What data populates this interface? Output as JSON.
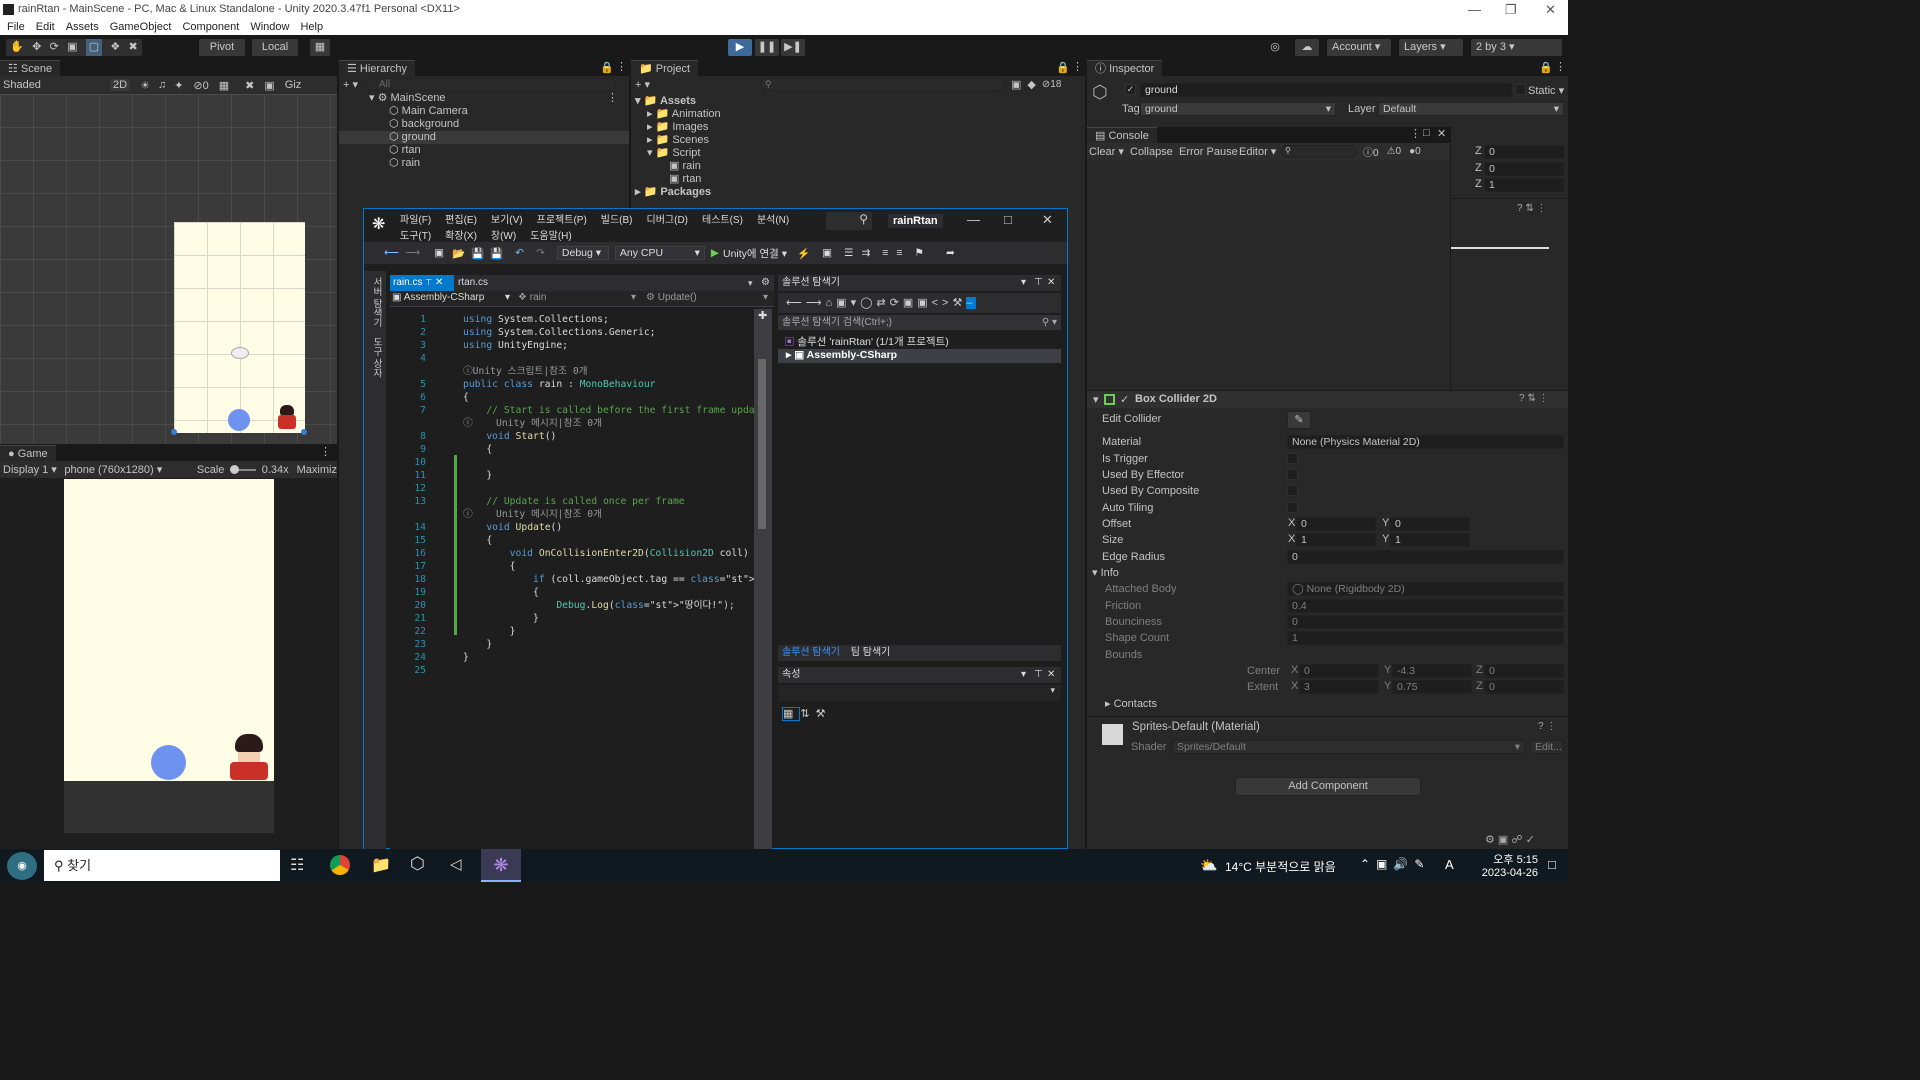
{
  "window": {
    "title": "rainRtan - MainScene - PC, Mac & Linux Standalone - Unity 2020.3.47f1 Personal <DX11>"
  },
  "menu": [
    "File",
    "Edit",
    "Assets",
    "GameObject",
    "Component",
    "Window",
    "Help"
  ],
  "toolbar": {
    "pivot": "Pivot",
    "local": "Local",
    "account": "Account",
    "layers": "Layers",
    "layout": "2 by 3"
  },
  "scene": {
    "tab": "Scene",
    "shading": "Shaded",
    "mode_2d": "2D",
    "gizmos": "Giz",
    "hidden_count": "0"
  },
  "game": {
    "tab": "Game",
    "display": "Display 1",
    "resolution": "phone (760x1280)",
    "scale_label": "Scale",
    "scale_value": "0.34x",
    "maximize": "Maximiz"
  },
  "hierarchy": {
    "tab": "Hierarchy",
    "search_placeholder": "All",
    "scene": "MainScene",
    "items": [
      "Main Camera",
      "background",
      "ground",
      "rtan",
      "rain"
    ]
  },
  "project": {
    "tab": "Project",
    "badge": "18",
    "root": "Assets",
    "folders": [
      "Animation",
      "Images",
      "Scenes",
      "Script"
    ],
    "scripts": [
      "rain",
      "rtan"
    ],
    "packages": "Packages"
  },
  "inspector": {
    "tab": "Inspector",
    "object_name": "ground",
    "static": "Static",
    "tag_label": "Tag",
    "tag": "ground",
    "layer_label": "Layer",
    "layer": "Default",
    "transform_z": [
      "0",
      "0",
      "1"
    ],
    "box_collider": {
      "title": "Box Collider 2D",
      "edit_collider": "Edit Collider",
      "material_label": "Material",
      "material": "None (Physics Material 2D)",
      "is_trigger": "Is Trigger",
      "used_by_effector": "Used By Effector",
      "used_by_composite": "Used By Composite",
      "auto_tiling": "Auto Tiling",
      "offset_label": "Offset",
      "offset_x": "0",
      "offset_y": "0",
      "size_label": "Size",
      "size_x": "1",
      "size_y": "1",
      "edge_radius_label": "Edge Radius",
      "edge_radius": "0",
      "info": "Info",
      "attached_body_label": "Attached Body",
      "attached_body": "None (Rigidbody 2D)",
      "friction_label": "Friction",
      "friction": "0.4",
      "bounciness_label": "Bounciness",
      "bounciness": "0",
      "shape_count_label": "Shape Count",
      "shape_count": "1",
      "bounds": "Bounds",
      "center_label": "Center",
      "center_x": "0",
      "center_y": "-4.3",
      "center_z": "0",
      "extent_label": "Extent",
      "extent_x": "3",
      "extent_y": "0.75",
      "extent_z": "0",
      "contacts": "Contacts"
    },
    "material": {
      "name": "Sprites-Default (Material)",
      "shader_label": "Shader",
      "shader": "Sprites/Default",
      "edit": "Edit..."
    },
    "add_component": "Add Component"
  },
  "console": {
    "tab": "Console",
    "clear": "Clear",
    "collapse": "Collapse",
    "error_pause": "Error Pause",
    "editor": "Editor",
    "log_count": "0",
    "warn_count": "0",
    "error_count": "0"
  },
  "vs": {
    "menu": [
      "파일(F)",
      "편집(E)",
      "보기(V)",
      "프로젝트(P)",
      "빌드(B)",
      "디버그(D)",
      "테스트(S)",
      "분석(N)",
      "도구(T)",
      "확장(X)",
      "창(W)",
      "도움말(H)"
    ],
    "solution_name": "rainRtan",
    "config": "Debug",
    "platform": "Any CPU",
    "run": "Unity에 연결",
    "tabs": [
      "rain.cs",
      "rtan.cs"
    ],
    "nav": [
      "Assembly-CSharp",
      "rain",
      "Update()"
    ],
    "side_tabs": [
      "서버 탐색기",
      "도구 상자"
    ],
    "code": [
      {
        "n": "1",
        "t": "using System.Collections;"
      },
      {
        "n": "2",
        "t": "using System.Collections.Generic;"
      },
      {
        "n": "3",
        "t": "using UnityEngine;"
      },
      {
        "n": "4",
        "t": ""
      },
      {
        "n": "",
        "t": "Unity 스크립트|참조 0개"
      },
      {
        "n": "5",
        "t": "public class rain : MonoBehaviour"
      },
      {
        "n": "6",
        "t": "{"
      },
      {
        "n": "7",
        "t": "    // Start is called before the first frame updat"
      },
      {
        "n": "",
        "t": "    Unity 메시지|참조 0개"
      },
      {
        "n": "8",
        "t": "    void Start()"
      },
      {
        "n": "9",
        "t": "    {"
      },
      {
        "n": "10",
        "t": ""
      },
      {
        "n": "11",
        "t": "    }"
      },
      {
        "n": "12",
        "t": ""
      },
      {
        "n": "13",
        "t": "    // Update is called once per frame"
      },
      {
        "n": "",
        "t": "    Unity 메시지|참조 0개"
      },
      {
        "n": "14",
        "t": "    void Update()"
      },
      {
        "n": "15",
        "t": "    {"
      },
      {
        "n": "16",
        "t": "        void OnCollisionEnter2D(Collision2D coll)"
      },
      {
        "n": "17",
        "t": "        {"
      },
      {
        "n": "18",
        "t": "            if (coll.gameObject.tag == \"ground\")"
      },
      {
        "n": "19",
        "t": "            {"
      },
      {
        "n": "20",
        "t": "                Debug.Log(\"땅이다!\");"
      },
      {
        "n": "21",
        "t": "            }"
      },
      {
        "n": "22",
        "t": "        }"
      },
      {
        "n": "23",
        "t": "    }"
      },
      {
        "n": "24",
        "t": "}"
      },
      {
        "n": "25",
        "t": ""
      }
    ],
    "solution_explorer": {
      "title": "솔루션 탐색기",
      "search": "솔루션 탐색기 검색(Ctrl+;)",
      "solution": "솔루션 'rainRtan' (1/1개 프로젝트)",
      "project": "Assembly-CSharp",
      "tab1": "솔루션 탐색기",
      "tab2": "팀 탐색기"
    },
    "properties": {
      "title": "속성"
    }
  },
  "taskbar": {
    "search": "찾기",
    "weather": "14°C  부분적으로 맑음",
    "time": "오후 5:15",
    "date": "2023-04-26",
    "ime": "A"
  }
}
